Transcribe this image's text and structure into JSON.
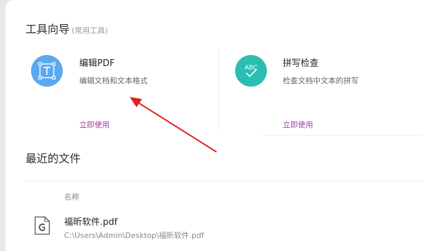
{
  "tools": {
    "title": "工具向导",
    "subtitle": "(常用工具)",
    "items": [
      {
        "name": "编辑PDF",
        "description": "编辑文档和文本格式",
        "action": "立即使用",
        "icon": "edit-text-icon",
        "color": "#5aa9f0"
      },
      {
        "name": "拼写检查",
        "description": "检查文档中文本的拼写",
        "action": "立即使用",
        "icon": "spell-check-icon",
        "icon_text": "ABC",
        "color": "#2bbdb1"
      }
    ]
  },
  "recent": {
    "title": "最近的文件",
    "column_name": "名称",
    "files": [
      {
        "name": "福昕软件.pdf",
        "path": "C:\\Users\\Admin\\Desktop\\福昕软件.pdf",
        "icon": "pdf-file-icon"
      }
    ]
  },
  "annotation": {
    "type": "arrow",
    "color": "#e0201c"
  }
}
